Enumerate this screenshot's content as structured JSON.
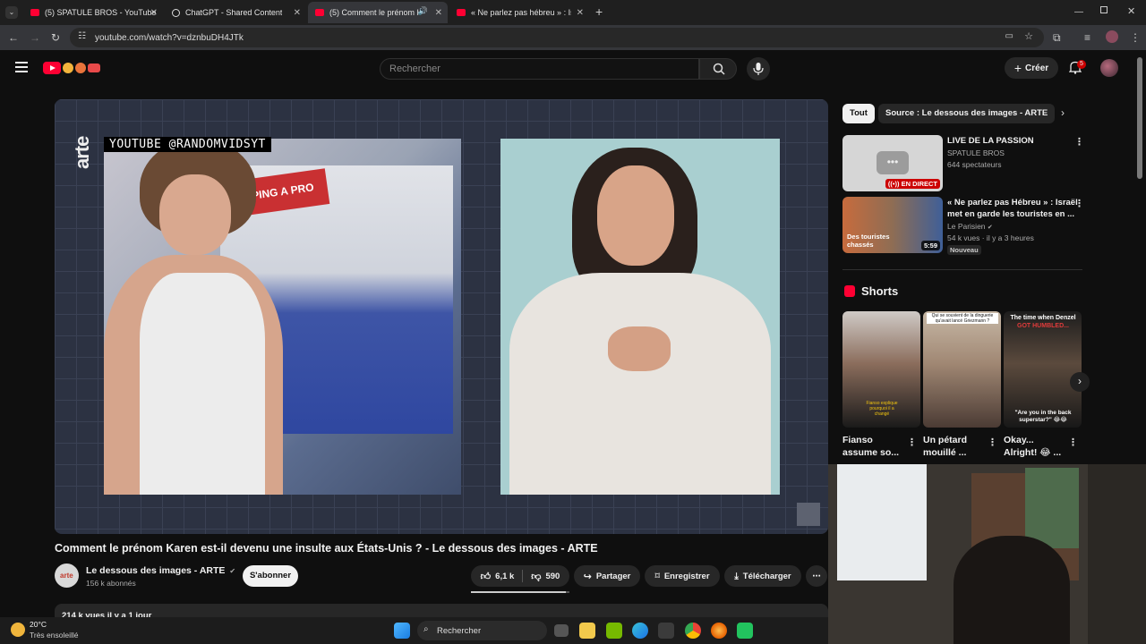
{
  "browser": {
    "tabs": [
      {
        "title": "(5) SPATULE BROS - YouTube",
        "icon": "youtube-icon"
      },
      {
        "title": "ChatGPT - Shared Content",
        "icon": "chatgpt-icon"
      },
      {
        "title": "(5) Comment le prénom Ka",
        "icon": "youtube-icon",
        "active": true
      },
      {
        "title": "« Ne parlez pas hébreu » : Israë",
        "icon": "youtube-icon"
      }
    ],
    "url": "youtube.com/watch?v=dznbuDH4JTk"
  },
  "header": {
    "search_placeholder": "Rechercher",
    "create_label": "Créer",
    "notifications_count": "5"
  },
  "player": {
    "overlay_handle": "YOUTUBE @RANDOMVIDSYT",
    "channel_logo": "arte",
    "sign_text": "PING A PRO"
  },
  "video": {
    "title": "Comment le prénom Karen est-il devenu une insulte aux États-Unis ? - Le dessous des images - ARTE",
    "channel": "Le dessous des images - ARTE",
    "subscribers": "156 k abonnés",
    "subscribe_label": "S'abonner",
    "likes": "6,1 k",
    "dislikes": "590",
    "like_ratio": 0.96,
    "share_label": "Partager",
    "save_label": "Enregistrer",
    "download_label": "Télécharger",
    "description_meta": "214 k vues  il y a 1 jour"
  },
  "sidebar": {
    "chips": [
      "Tout",
      "Source : Le dessous des images - ARTE"
    ],
    "recommendations": [
      {
        "title": "LIVE DE LA PASSION",
        "channel": "SPATULE BROS",
        "meta": "644 spectateurs",
        "badge": "EN DIRECT"
      },
      {
        "title_line1": "« Ne parlez pas Hébreu » : Israël",
        "title_line2": "met en garde les touristes en ...",
        "channel": "Le Parisien",
        "meta": "54 k vues · il y a 3 heures",
        "badge": "Nouveau",
        "duration": "5:59",
        "thumb_text": "Des touristes chassés"
      }
    ],
    "shorts_heading": "Shorts",
    "shorts": [
      {
        "line1": "Fianso",
        "line2": "assume so...",
        "caption": "Fianso explique pourquoi il a changé"
      },
      {
        "line1": "Un pétard",
        "line2": "mouillé ...",
        "caption": "Qui se souvient de la dinguerie qu'avait lancé Griezmann ?"
      },
      {
        "line1": "Okay...",
        "line2": "Alright! 😂 ...",
        "caption_top": "The time when Denzel",
        "caption_red": "GOT HUMBLED...",
        "caption_bottom": "\"Are you in the back superstar?\" 😂😂"
      }
    ]
  },
  "taskbar": {
    "weather_temp": "20°C",
    "weather_desc": "Très ensoleillé",
    "search_label": "Rechercher"
  }
}
